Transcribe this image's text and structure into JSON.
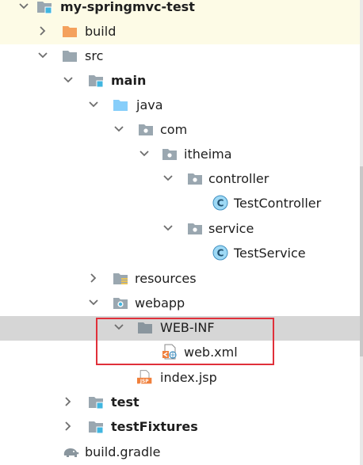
{
  "tree": {
    "root": {
      "label": "my-springmvc-test"
    },
    "build": {
      "label": "build"
    },
    "src": {
      "label": "src"
    },
    "main": {
      "label": "main"
    },
    "java": {
      "label": "java"
    },
    "com": {
      "label": "com"
    },
    "itheima": {
      "label": "itheima"
    },
    "controller": {
      "label": "controller"
    },
    "test_controller": {
      "label": "TestController"
    },
    "service": {
      "label": "service"
    },
    "test_service": {
      "label": "TestService"
    },
    "resources": {
      "label": "resources"
    },
    "webapp": {
      "label": "webapp"
    },
    "web_inf": {
      "label": "WEB-INF"
    },
    "web_xml": {
      "label": "web.xml"
    },
    "index_jsp": {
      "label": "index.jsp"
    },
    "test": {
      "label": "test"
    },
    "test_fixtures": {
      "label": "testFixtures"
    },
    "build_gradle": {
      "label": "build.gradle"
    }
  },
  "icons": {
    "class_badge_letter": "C",
    "jsp_badge_text": "JSP"
  },
  "colors": {
    "folder_gray": "#9aa7b0",
    "folder_orange": "#f4a15d",
    "folder_blue": "#87cefa",
    "module_badge": "#40b6e0",
    "class_circle": "#9ed9f5",
    "jsp_orange": "#f0803c",
    "selection_gray": "#d6d6d6",
    "row_highlight": "#fdfbe6",
    "annotation_red": "#e0303a"
  }
}
